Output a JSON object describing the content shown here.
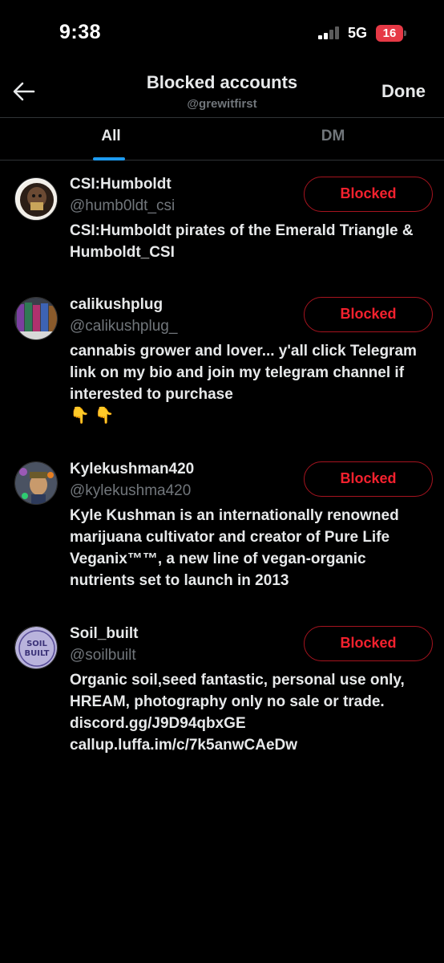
{
  "status_bar": {
    "time": "9:38",
    "network": "5G",
    "battery": "16"
  },
  "header": {
    "back_icon": "arrow-left-icon",
    "title": "Blocked accounts",
    "subtitle": "@grewitfirst",
    "done_label": "Done"
  },
  "tabs": [
    {
      "label": "All",
      "active": true
    },
    {
      "label": "DM",
      "active": false
    }
  ],
  "accounts": [
    {
      "name": "CSI:Humboldt",
      "handle": "@humb0ldt_csi",
      "bio": "CSI:Humboldt pirates of the Emerald Triangle & Humboldt_CSI",
      "button": "Blocked"
    },
    {
      "name": "calikushplug",
      "handle": "@calikushplug_",
      "bio": "cannabis grower and lover... y'all click Telegram link on my bio and join my telegram channel if interested to purchase",
      "bio_emoji": "👇 👇",
      "button": "Blocked"
    },
    {
      "name": "Kylekushman420",
      "handle": "@kylekushma420",
      "bio": "Kyle Kushman is an internationally renowned marijuana cultivator and creator of Pure Life Veganix™™, a new line of vegan-organic nutrients set to launch in 2013",
      "button": "Blocked"
    },
    {
      "name": "Soil_built",
      "handle": "@soilbuilt",
      "bio": "Organic soil,seed fantastic, personal use only, HREAM, photography only no sale or trade. discord.gg/J9D94qbxGE callup.luffa.im/c/7k5anwCAeDw",
      "avatar_text": "SOIL BUILT",
      "button": "Blocked"
    }
  ],
  "colors": {
    "background": "#000000",
    "text_primary": "#e7e9ea",
    "text_secondary": "#71767b",
    "accent_blue": "#1d9bf0",
    "blocked_red": "#f4212e",
    "blocked_border": "#a6141f"
  }
}
